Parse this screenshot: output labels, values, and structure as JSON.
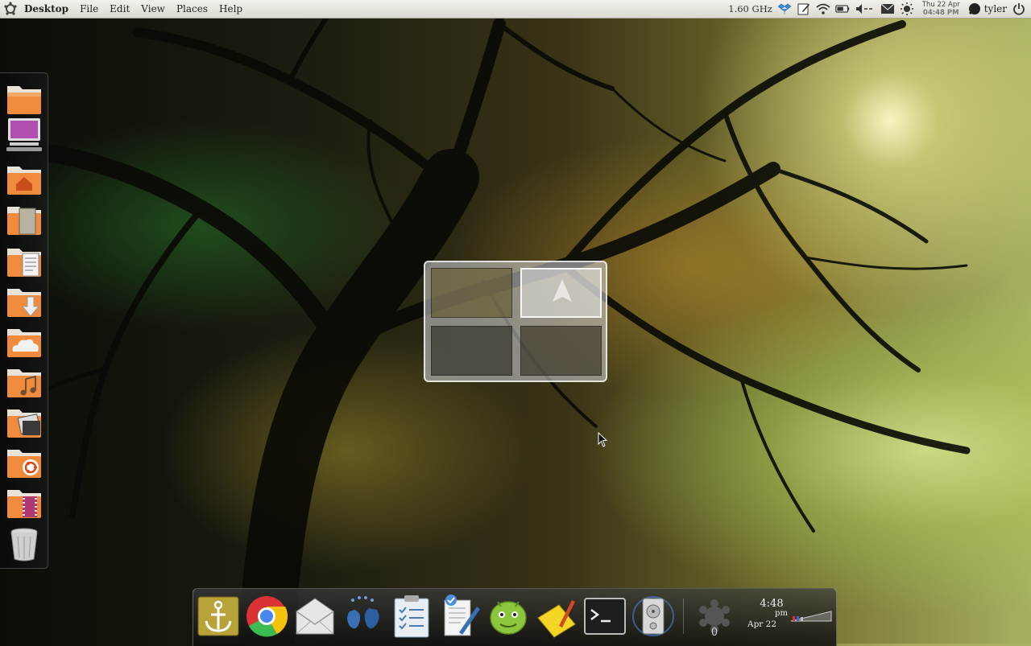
{
  "top_panel": {
    "menus": [
      "Desktop",
      "File",
      "Edit",
      "View",
      "Places",
      "Help"
    ],
    "cpu_freq": "1.60 GHz",
    "clock_date": "Thu 22 Apr",
    "clock_time": "04:48 PM",
    "username": "tyler",
    "tray_icons": [
      "dropbox-icon",
      "notes-icon",
      "wifi-icon",
      "battery-icon",
      "volume-icon",
      "mail-icon",
      "weather-icon",
      "user-status-icon",
      "power-icon"
    ]
  },
  "launcher": {
    "items": [
      "folder",
      "computer",
      "home-folder",
      "documents-folder",
      "text-folder",
      "downloads-folder",
      "cloud-folder",
      "music-folder",
      "pictures-folder",
      "ubuntu-folder",
      "videos-folder",
      "trash"
    ]
  },
  "dock": {
    "items": [
      "anchor",
      "chrome",
      "mail",
      "pidgin",
      "tasks",
      "document-editor",
      "android",
      "notes",
      "terminal",
      "disk-utility",
      "system-monitor"
    ],
    "clock_time": "4:48",
    "clock_ampm": "pm",
    "clock_date": "Apr 22"
  },
  "colors": {
    "panel": "#e7e4de",
    "accent": "#e6702e",
    "folder": "#f08a3c"
  }
}
